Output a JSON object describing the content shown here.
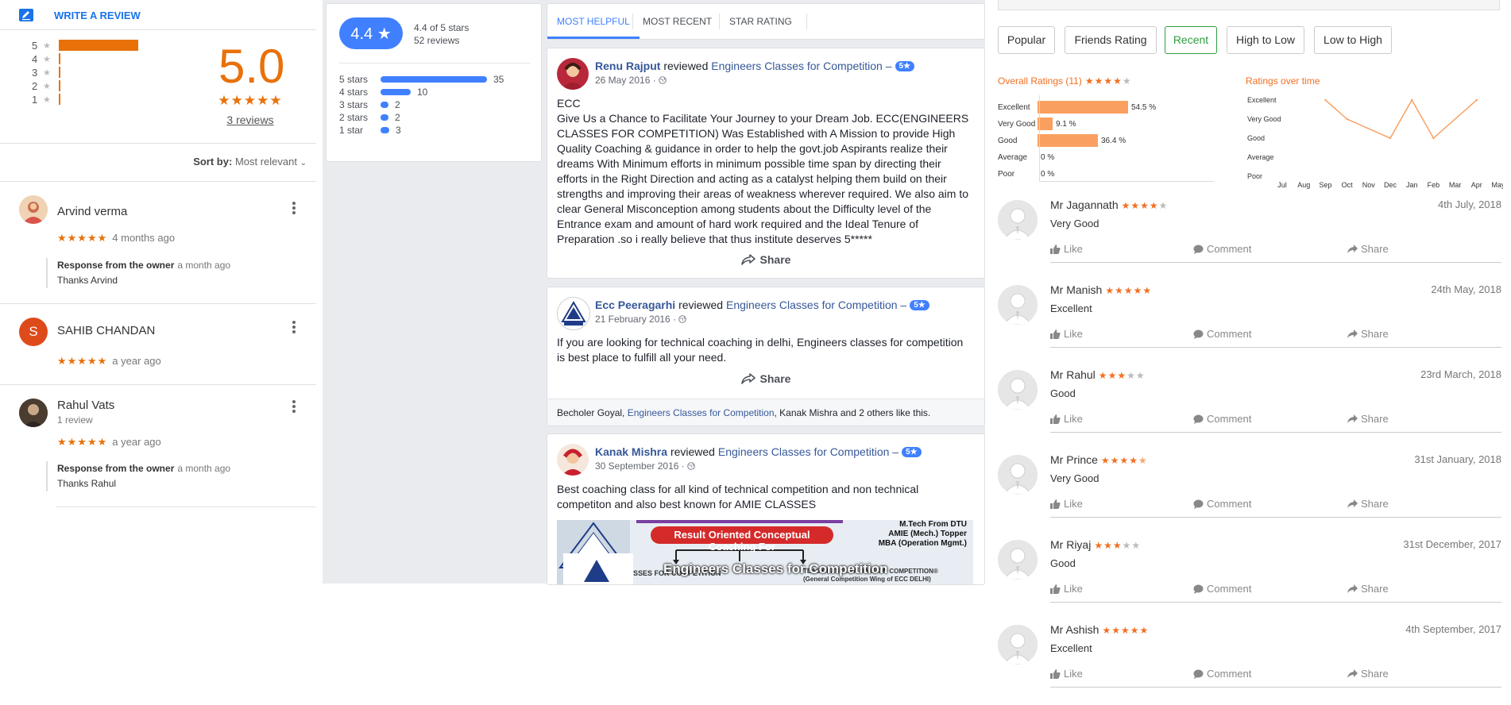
{
  "google_panel": {
    "write_review": "WRITE A REVIEW",
    "histogram": [
      {
        "stars": "5",
        "fraction": 1.0
      },
      {
        "stars": "4",
        "fraction": 0
      },
      {
        "stars": "3",
        "fraction": 0
      },
      {
        "stars": "2",
        "fraction": 0
      },
      {
        "stars": "1",
        "fraction": 0
      }
    ],
    "average": "5.0",
    "average_stars": "★★★★★",
    "review_count": "3 reviews",
    "sort_label": "Sort by:",
    "sort_value": "Most relevant",
    "reviews": [
      {
        "initial": "",
        "name": "Arvind verma",
        "sub": "",
        "stars": "★★★★★",
        "time": "4 months ago",
        "response_label": "Response from the owner",
        "response_time": "a month ago",
        "response_text": "Thanks Arvind"
      },
      {
        "initial": "S",
        "name": "SAHIB CHANDAN",
        "sub": "",
        "stars": "★★★★★",
        "time": "a year ago"
      },
      {
        "initial": "",
        "name": "Rahul Vats",
        "sub": "1 review",
        "stars": "★★★★★",
        "time": "a year ago",
        "response_label": "Response from the owner",
        "response_time": "a month ago",
        "response_text": "Thanks Rahul"
      }
    ],
    "colors": {
      "accent": "#e8710a",
      "link": "#1a73e8",
      "avatar_s": "#dd4b1a"
    }
  },
  "facebook_panel": {
    "rating_pill": "4.4 ★",
    "rating_text": "4.4 of 5 stars",
    "reviews_text": "52 reviews",
    "breakdown": [
      {
        "label": "5 stars",
        "count": 35
      },
      {
        "label": "4 stars",
        "count": 10
      },
      {
        "label": "3 stars",
        "count": 2
      },
      {
        "label": "2 stars",
        "count": 2
      },
      {
        "label": "1 star",
        "count": 3
      }
    ],
    "tabs": [
      "MOST HELPFUL",
      "MOST RECENT",
      "STAR RATING"
    ],
    "active_tab": 0,
    "posts": [
      {
        "author": "Renu Rajput",
        "verb": "reviewed",
        "page": "Engineers Classes for Competition –",
        "badge": "5★",
        "date": "26 May 2016 ·",
        "text_lines": [
          "ECC",
          "Give Us a Chance to Facilitate Your Journey to your Dream Job. ECC(ENGINEERS",
          "CLASSES FOR COMPETITION) Was Established with A Mission to provide High",
          "Quality Coaching & guidance in order to help the govt.job Aspirants realize their",
          "dreams With Minimum efforts in minimum possible time span by directing their",
          "efforts in the Right Direction and acting as a catalyst helping them build on their",
          "strengths and improving their areas of weakness wherever required. We also aim to",
          "clear General Misconception among students about the Difficulty level of the",
          "Entrance exam and amount of hard work required and the Ideal Tenure of",
          "Preparation .so i really believe that thus institute deserves 5*****"
        ],
        "share": "Share"
      },
      {
        "author": "Ecc Peeragarhi",
        "verb": "reviewed",
        "page": "Engineers Classes for Competition –",
        "badge": "5★",
        "date": "21 February 2016 ·",
        "text_lines": [
          "If you are looking for technical coaching in delhi, Engineers classes for competition",
          "is best place to fulfill all your need."
        ],
        "share": "Share",
        "likes": {
          "prefix": "Becholer Goyal,",
          "page": "Engineers Classes for Competition",
          "suffix": ", Kanak Mishra and 2 others like this."
        }
      },
      {
        "author": "Kanak Mishra",
        "verb": "reviewed",
        "page": "Engineers Classes for Competition –",
        "badge": "5★",
        "date": "30 September 2016 ·",
        "text_lines": [
          "Best coaching class for all kind of technical competition and non technical",
          "competiton and also best known for AMIE CLASSES"
        ],
        "banner": {
          "headline": "Result Oriented Conceptual Coaching For",
          "side": [
            "M.Tech From DTU",
            "AMIE (Mech.) Topper",
            "MBA (Operation Mgmt.)"
          ],
          "overlay": "Engineers Classes for Competition",
          "left1": "SSES FOR COMPETITION",
          "right1": "TEAS CLASSES A DIVISION COMPETITION®",
          "right2": "(General Competition Wing of ECC DELHI)"
        }
      }
    ],
    "colors": {
      "blue": "#4080ff",
      "link": "#365899",
      "bg": "#e9ebee"
    }
  },
  "ratings_panel": {
    "filters": [
      "Popular",
      "Friends Rating",
      "Recent",
      "High to Low",
      "Low to High"
    ],
    "active_filter": 2,
    "overall_title": "Overall Ratings (11)",
    "overall_stars": "★★★★★",
    "overall_stars_filled": 4,
    "ratings": [
      {
        "label": "Excellent",
        "percent": 54.5,
        "value": "54.5 %"
      },
      {
        "label": "Very Good",
        "percent": 9.1,
        "value": "9.1 %"
      },
      {
        "label": "Good",
        "percent": 36.4,
        "value": "36.4 %"
      },
      {
        "label": "Average",
        "percent": 0,
        "value": "0 %"
      },
      {
        "label": "Poor",
        "percent": 0,
        "value": "0 %"
      }
    ],
    "over_time_title": "Ratings over time",
    "chart_data": {
      "type": "line",
      "title": "Ratings over time",
      "y_categories": [
        "Excellent",
        "Very Good",
        "Good",
        "Average",
        "Poor"
      ],
      "x": [
        "Jul",
        "Aug",
        "Sep",
        "Oct",
        "Nov",
        "Dec",
        "Jan",
        "Feb",
        "Mar",
        "Apr",
        "May"
      ],
      "series": [
        {
          "values": [
            null,
            null,
            "Excellent",
            "Very Good",
            null,
            "Good",
            "Excellent",
            "Good",
            null,
            "Excellent",
            null
          ]
        }
      ]
    },
    "items": [
      {
        "name": "Mr Jagannath",
        "stars_filled": 4,
        "date": "4th July, 2018",
        "text": "Very Good"
      },
      {
        "name": "Mr Manish",
        "stars_filled": 5,
        "date": "24th May, 2018",
        "text": "Excellent"
      },
      {
        "name": "Mr Rahul",
        "stars_filled": 3,
        "date": "23rd March, 2018",
        "text": "Good"
      },
      {
        "name": "Mr Prince",
        "stars_filled": 4.5,
        "date": "31st January, 2018",
        "text": "Very Good"
      },
      {
        "name": "Mr Riyaj",
        "stars_filled": 3,
        "date": "31st December, 2017",
        "text": "Good"
      },
      {
        "name": "Mr Ashish",
        "stars_filled": 5,
        "date": "4th September, 2017",
        "text": "Excellent"
      }
    ],
    "actions": {
      "like": "Like",
      "comment": "Comment",
      "share": "Share"
    },
    "colors": {
      "accent": "#f36f21",
      "bar": "#f9a060",
      "active": "#2e9e3e"
    }
  }
}
